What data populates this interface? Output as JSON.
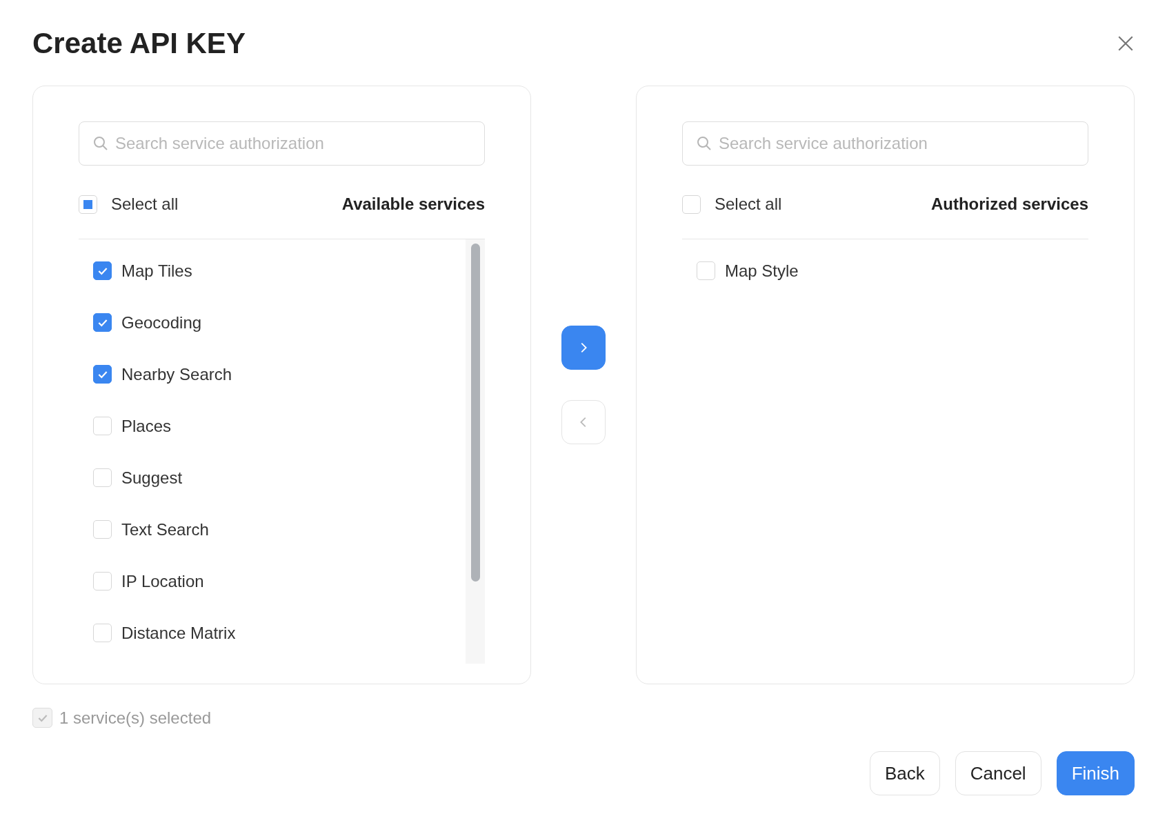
{
  "dialog": {
    "title": "Create API KEY"
  },
  "panels": [
    {
      "search": {
        "placeholder": "Search service authorization"
      },
      "select_all": {
        "label": "Select all",
        "checked": false,
        "indeterminate": true
      },
      "heading": "Available services",
      "scrollable": true,
      "items": [
        {
          "label": "Map Tiles",
          "checked": true
        },
        {
          "label": "Geocoding",
          "checked": true
        },
        {
          "label": "Nearby Search",
          "checked": true
        },
        {
          "label": "Places",
          "checked": false
        },
        {
          "label": "Suggest",
          "checked": false
        },
        {
          "label": "Text Search",
          "checked": false
        },
        {
          "label": "IP Location",
          "checked": false
        },
        {
          "label": "Distance Matrix",
          "checked": false
        }
      ]
    },
    {
      "search": {
        "placeholder": "Search service authorization"
      },
      "select_all": {
        "label": "Select all",
        "checked": false,
        "indeterminate": false
      },
      "heading": "Authorized services",
      "scrollable": false,
      "items": [
        {
          "label": "Map Style",
          "checked": false
        }
      ]
    }
  ],
  "transfer_buttons": [
    {
      "kind": "forward",
      "enabled": true
    },
    {
      "kind": "back",
      "enabled": false
    }
  ],
  "footer": {
    "checkbox": {
      "checked": true,
      "disabled": true
    },
    "summary": "1 service(s) selected"
  },
  "buttons": [
    {
      "label": "Back",
      "kind": "default"
    },
    {
      "label": "Cancel",
      "kind": "default"
    },
    {
      "label": "Finish",
      "kind": "primary"
    }
  ]
}
